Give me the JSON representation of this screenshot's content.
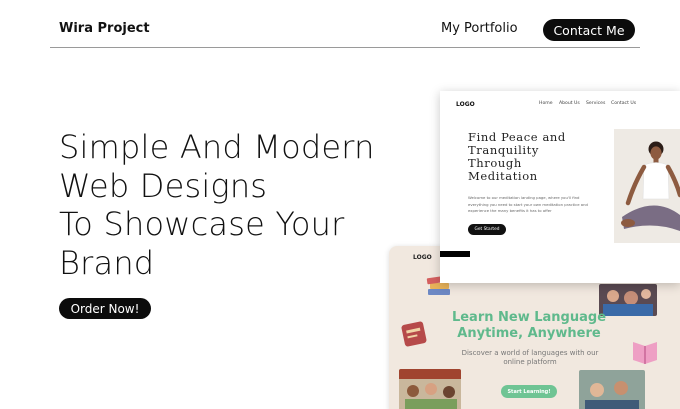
{
  "header": {
    "brand": "Wira Project",
    "nav_portfolio": "My Portfolio",
    "nav_contact": "Contact Me"
  },
  "hero": {
    "title_lines": [
      "Simple And Modern",
      "Web Designs",
      "To Showcase Your",
      "Brand"
    ],
    "cta_label": "Order Now!"
  },
  "mockup_meditation": {
    "logo": "LOGO",
    "nav": [
      "Home",
      "About Us",
      "Services",
      "Contact Us"
    ],
    "title_lines": [
      "Find Peace and",
      "Tranquility",
      "Through",
      "Meditation"
    ],
    "body": "Welcome to our meditation landing page, where you'll find everything you need to start your own meditation practice and experience the many benefits it has to offer",
    "button": "Get Started"
  },
  "mockup_language": {
    "logo": "LOGO",
    "title_lines": [
      "Learn New Language",
      "Anytime, Anywhere"
    ],
    "subtitle": "Discover a world of languages with our online platform",
    "button": "Start Learning!"
  },
  "colors": {
    "accent_dark": "#0c0c0c",
    "language_green": "#5fb98c",
    "language_bg": "#f1e8df"
  }
}
